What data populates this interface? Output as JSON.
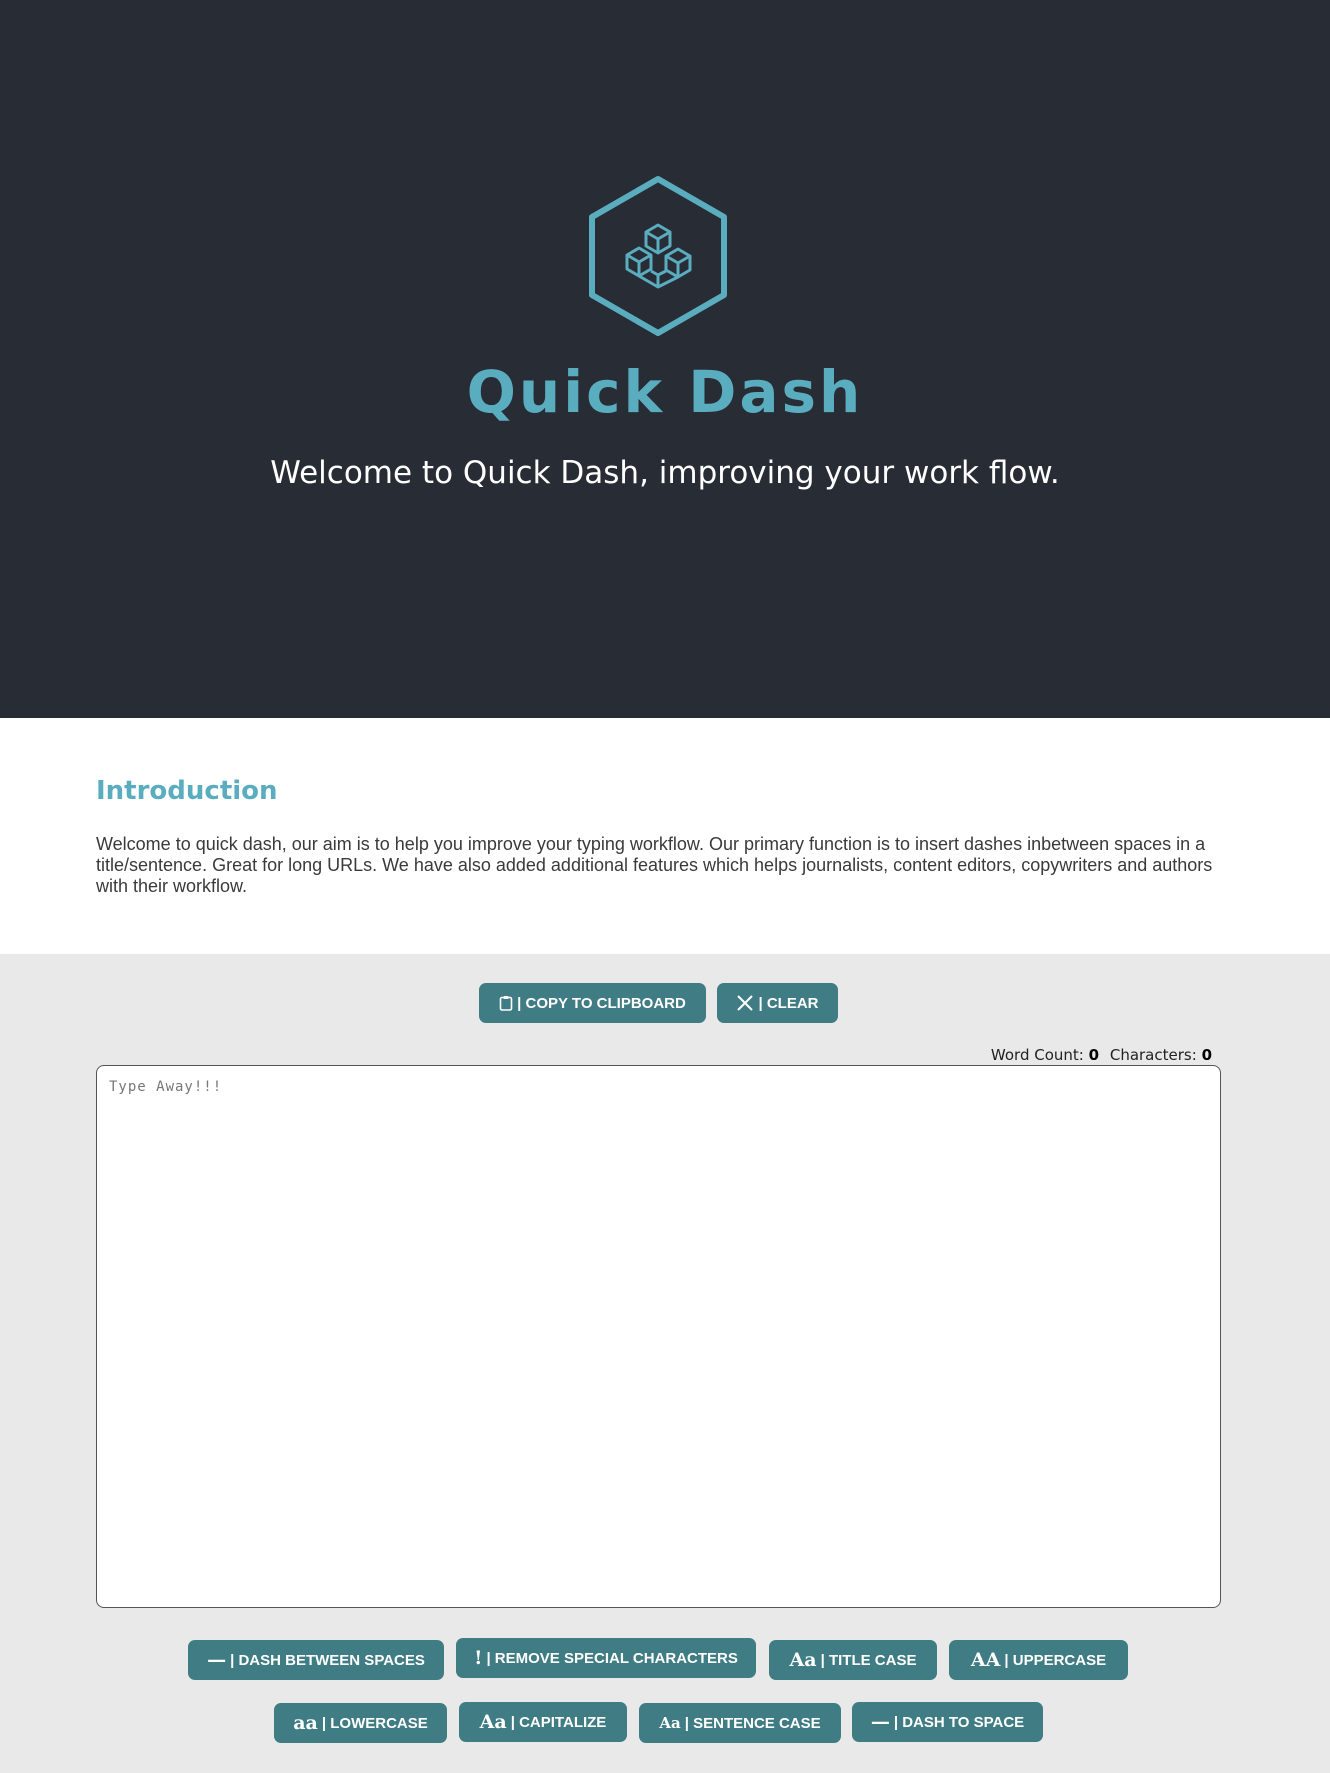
{
  "colors": {
    "accent": "#5aacbf",
    "button": "#3f7c83",
    "hero_bg": "#282c34"
  },
  "hero": {
    "logo_icon": "hexagon-cubes-icon",
    "title": "Quick Dash",
    "subtitle": "Welcome to Quick Dash, improving your work flow."
  },
  "intro": {
    "heading": "Introduction",
    "body": "Welcome to quick dash, our aim is to help you improve your typing workflow. Our primary function is to insert dashes inbetween spaces in a title/sentence. Great for long URLs. We have also added additional features which helps journalists, content editors, copywriters and authors with their workflow."
  },
  "toolbar": {
    "copy": {
      "icon": "clipboard-icon",
      "label": "| COPY TO CLIPBOARD"
    },
    "clear": {
      "icon": "close-icon",
      "label": "| CLEAR"
    }
  },
  "counts": {
    "word_label": "Word Count:",
    "word_value": "0",
    "char_label": "Characters:",
    "char_value": "0"
  },
  "editor": {
    "placeholder": "Type Away!!!",
    "value": ""
  },
  "actions": [
    {
      "icon": "dash-icon",
      "glyph": "—",
      "label": "| DASH BETWEEN SPACES"
    },
    {
      "icon": "exclamation-icon",
      "glyph": "!",
      "label": "| REMOVE SPECIAL CHARACTERS"
    },
    {
      "icon": "title-case-icon",
      "glyph": "Aa",
      "label": "| TITLE CASE"
    },
    {
      "icon": "uppercase-icon",
      "glyph": "AA",
      "label": "| UPPERCASE"
    },
    {
      "icon": "lowercase-icon",
      "glyph": "aa",
      "label": "| LOWERCASE"
    },
    {
      "icon": "capitalize-icon",
      "glyph": "Aa",
      "label": "| CAPITALIZE"
    },
    {
      "icon": "sentence-case-icon",
      "glyph": "Aa",
      "label": "| SENTENCE CASE"
    },
    {
      "icon": "dash-icon",
      "glyph": "—",
      "label": "| DASH TO SPACE"
    }
  ]
}
